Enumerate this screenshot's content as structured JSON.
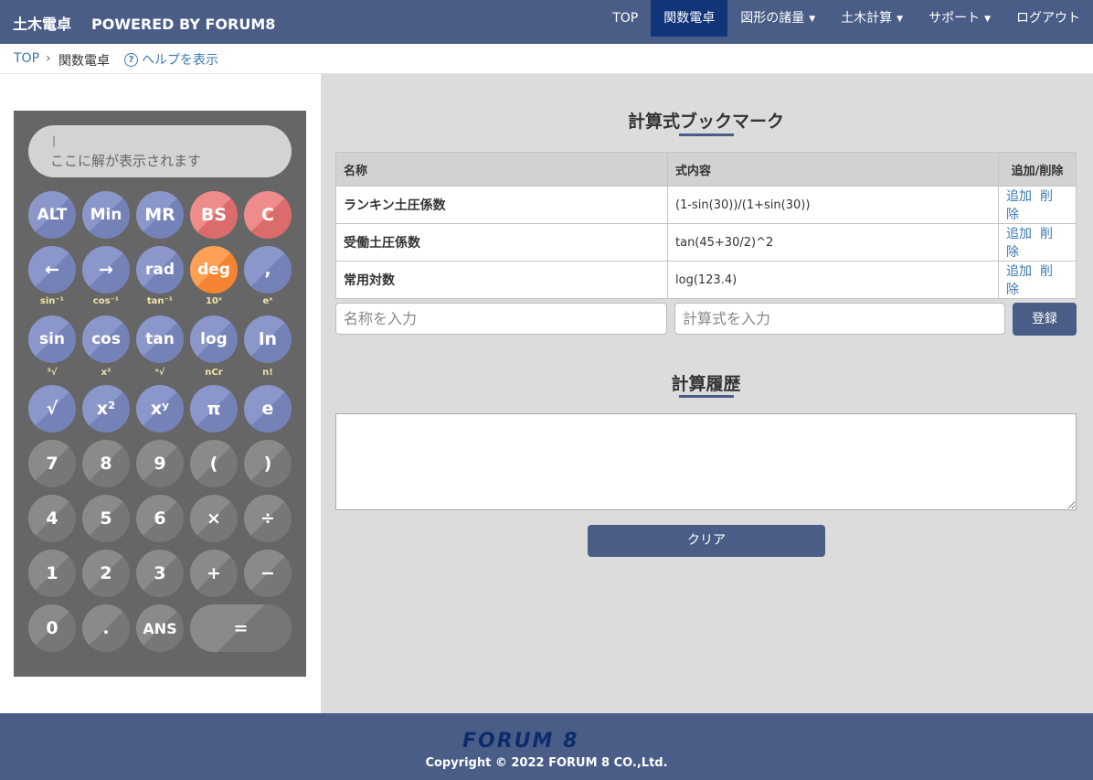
{
  "navbar": {
    "brand": "土木電卓",
    "brand_sub": "POWERED BY FORUM8",
    "items": [
      {
        "label": "TOP"
      },
      {
        "label": "関数電卓"
      },
      {
        "label": "図形の諸量"
      },
      {
        "label": "土木計算"
      },
      {
        "label": "サポート"
      },
      {
        "label": "ログアウト"
      }
    ],
    "active_item": "関数電卓"
  },
  "breadcrumb": {
    "home": "TOP",
    "separator": "›",
    "current": "関数電卓",
    "help": "ヘルプを表示",
    "help_icon": "question-circle-icon"
  },
  "calculator": {
    "display_cursor": "|",
    "display_placeholder": "ここに解が表示されます",
    "rows": [
      [
        "ALT",
        "Min",
        "MR",
        "BS",
        "C"
      ],
      [
        "←",
        "→",
        "rad",
        "deg",
        ","
      ],
      [
        "sin",
        "cos",
        "tan",
        "log",
        "ln"
      ],
      [
        "√",
        "x²",
        "xʸ",
        "π",
        "e"
      ],
      [
        "7",
        "8",
        "9",
        "(",
        ")"
      ],
      [
        "4",
        "5",
        "6",
        "×",
        "÷"
      ],
      [
        "1",
        "2",
        "3",
        "+",
        "−"
      ],
      [
        "0",
        ".",
        "ANS",
        "="
      ]
    ],
    "alt_labels_row3": [
      "sin⁻¹",
      "cos⁻¹",
      "tan⁻¹",
      "10ˣ",
      "eˣ"
    ],
    "alt_labels_row4": [
      "³√",
      "x³",
      "ˣ√",
      "nCr",
      "n!"
    ],
    "colors": {
      "function": "#8b97ca",
      "danger": "#ee8b8b",
      "active": "#ffa055",
      "number": "#8a8a8a",
      "body": "#666666",
      "alt_label": "#f1e3a8"
    }
  },
  "bookmarks": {
    "title": "計算式ブックマーク",
    "columns": [
      "名称",
      "式内容",
      "追加/削除"
    ],
    "rows": [
      {
        "name": "ランキン土圧係数",
        "expr": "(1-sin(30))/(1+sin(30))",
        "add": "追加",
        "del": "削除"
      },
      {
        "name": "受働土圧係数",
        "expr": "tan(45+30/2)^2",
        "add": "追加",
        "del": "削除"
      },
      {
        "name": "常用対数",
        "expr": "log(123.4)",
        "add": "追加",
        "del": "削除"
      }
    ],
    "name_placeholder": "名称を入力",
    "expr_placeholder": "計算式を入力",
    "register": "登録"
  },
  "history": {
    "title": "計算履歴",
    "value": "",
    "clear": "クリア"
  },
  "footer": {
    "logo": "FORUM 8",
    "copyright": "Copyright © 2022 FORUM 8 CO.,Ltd."
  },
  "theme": {
    "navbar": "#4a5d87",
    "nav_active": "#10357a",
    "link": "#3a79b4",
    "panel": "#dcdcdc"
  }
}
